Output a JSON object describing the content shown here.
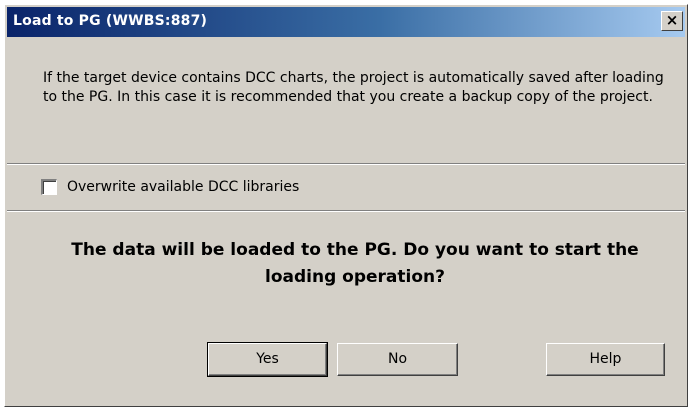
{
  "window": {
    "title": "Load to PG (WWBS:887)",
    "close_label": "×"
  },
  "message": {
    "info": "If the target device contains DCC charts, the project is automatically saved after loading to the PG. In this case it is recommended that you create a backup copy of the project.",
    "question": "The data will be loaded to the PG. Do you want to start the loading operation?"
  },
  "options": {
    "overwrite_label": "Overwrite available DCC libraries",
    "overwrite_checked": false
  },
  "buttons": {
    "yes_label": "Yes",
    "no_label": "No",
    "help_label": "Help"
  }
}
